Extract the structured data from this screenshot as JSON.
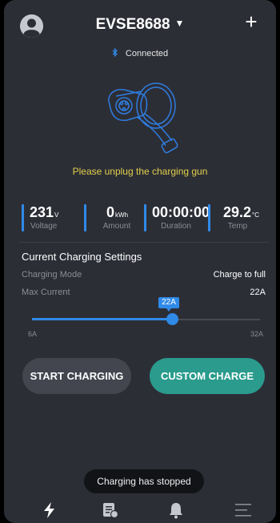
{
  "header": {
    "device_name": "EVSE8688",
    "connection_status": "Connected"
  },
  "notice": "Please unplug the charging gun",
  "stats": [
    {
      "value": "231",
      "unit": "V",
      "label": "Voltage"
    },
    {
      "value": "0",
      "unit": "kWh",
      "label": "Amount"
    },
    {
      "value": "00:00:00",
      "unit": "",
      "label": "Duration"
    },
    {
      "value": "29.2",
      "unit": "°C",
      "label": "Temp"
    }
  ],
  "settings": {
    "title": "Current Charging Settings",
    "mode_label": "Charging Mode",
    "mode_value": "Charge to full",
    "current_label": "Max Current",
    "current_value": "22A"
  },
  "slider": {
    "tooltip": "22A",
    "min_label": "6A",
    "max_label": "32A",
    "min": 6,
    "max": 32,
    "value": 22
  },
  "buttons": {
    "start": "START CHARGING",
    "custom": "CUSTOM CHARGE"
  },
  "toast": "Charging has stopped",
  "tabs": [
    "charge-tab",
    "records-tab",
    "notifications-tab",
    "menu-tab"
  ],
  "colors": {
    "background": "#2c2e36",
    "accent": "#2f8ae8",
    "custom_button": "#2a9b8d",
    "warning": "#e2cf4a"
  }
}
